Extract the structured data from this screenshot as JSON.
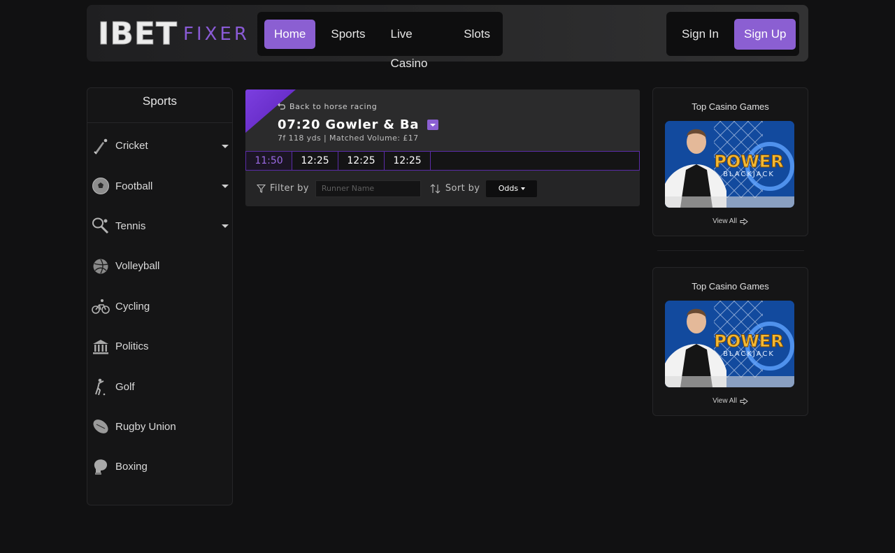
{
  "header": {
    "logo_main": "IBET",
    "logo_sub": "FIXER",
    "nav": [
      "Home",
      "Sports",
      "Live Casino",
      "Slots"
    ],
    "sign_in": "Sign In",
    "sign_up": "Sign Up"
  },
  "sidebar": {
    "title": "Sports",
    "items": [
      {
        "label": "Cricket",
        "icon": "cricket-icon",
        "expandable": true
      },
      {
        "label": "Football",
        "icon": "football-icon",
        "expandable": true
      },
      {
        "label": "Tennis",
        "icon": "tennis-icon",
        "expandable": true
      },
      {
        "label": "Volleyball",
        "icon": "volleyball-icon",
        "expandable": false
      },
      {
        "label": "Cycling",
        "icon": "cycling-icon",
        "expandable": false
      },
      {
        "label": "Politics",
        "icon": "politics-icon",
        "expandable": false
      },
      {
        "label": "Golf",
        "icon": "golf-icon",
        "expandable": false
      },
      {
        "label": "Rugby Union",
        "icon": "rugby-icon",
        "expandable": false
      },
      {
        "label": "Boxing",
        "icon": "boxing-icon",
        "expandable": false
      }
    ]
  },
  "event": {
    "back_label": "Back to horse racing",
    "title": "07:20 Gowler & Ba",
    "meta": "7f 118 yds | Matched Volume: £17",
    "times": [
      "11:50",
      "12:25",
      "12:25",
      "12:25"
    ],
    "active_time_index": 0,
    "filter_label": "Filter by",
    "runner_placeholder": "Runner Name",
    "sort_label": "Sort by",
    "sort_value": "Odds"
  },
  "casino": {
    "cards": [
      {
        "title": "Top Casino Games",
        "game_line1": "POWER",
        "game_line2": "BLACKJACK",
        "view_all": "View All"
      },
      {
        "title": "Top Casino Games",
        "game_line1": "POWER",
        "game_line2": "BLACKJACK",
        "view_all": "View All"
      }
    ]
  },
  "colors": {
    "accent": "#8b5fd2",
    "background": "#111112",
    "panel": "#252526"
  }
}
